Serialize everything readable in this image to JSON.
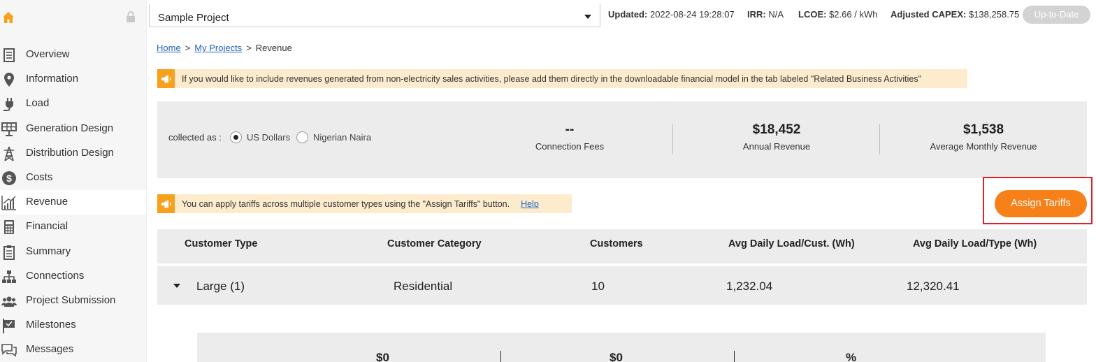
{
  "sidebar": {
    "items": [
      {
        "label": "Overview",
        "icon": "overview-icon"
      },
      {
        "label": "Information",
        "icon": "map-pin-icon"
      },
      {
        "label": "Load",
        "icon": "plug-icon"
      },
      {
        "label": "Generation Design",
        "icon": "solar-panel-icon"
      },
      {
        "label": "Distribution Design",
        "icon": "tower-icon"
      },
      {
        "label": "Costs",
        "icon": "dollar-coin-icon"
      },
      {
        "label": "Revenue",
        "icon": "bar-chart-icon",
        "active": true
      },
      {
        "label": "Financial",
        "icon": "calculator-icon"
      },
      {
        "label": "Summary",
        "icon": "document-icon"
      },
      {
        "label": "Connections",
        "icon": "network-icon"
      },
      {
        "label": "Project Submission",
        "icon": "users-icon"
      },
      {
        "label": "Milestones",
        "icon": "flag-icon"
      },
      {
        "label": "Messages",
        "icon": "chat-icon"
      }
    ]
  },
  "topbar": {
    "project": "Sample Project",
    "updated_label": "Updated:",
    "updated_value": "2022-08-24 19:28:07",
    "irr_label": "IRR:",
    "irr_value": "N/A",
    "lcoe_label": "LCOE:",
    "lcoe_value": "$2.66 / kWh",
    "capex_label": "Adjusted CAPEX:",
    "capex_value": "$138,258.75",
    "status_button": "Up-to-Date"
  },
  "breadcrumb": {
    "home": "Home",
    "projects": "My Projects",
    "current": "Revenue",
    "sep": ">"
  },
  "notices": {
    "top": "If you would like to include revenues generated from non-electricity sales activities, please add them directly in the downloadable financial model in the tab labeled \"Related Business Activities\"",
    "tariff": "You can apply tariffs across multiple customer types using the \"Assign Tariffs\" button.",
    "help": "Help"
  },
  "summary": {
    "collected_label": "collected as :",
    "currencies": [
      "US Dollars",
      "Nigerian Naira"
    ],
    "selected_currency": "US Dollars",
    "metrics": [
      {
        "value": "--",
        "label": "Connection Fees"
      },
      {
        "value": "$18,452",
        "label": "Annual Revenue"
      },
      {
        "value": "$1,538",
        "label": "Average Monthly Revenue"
      }
    ]
  },
  "assign_button": "Assign Tariffs",
  "table": {
    "columns": [
      "Customer Type",
      "Customer Category",
      "Customers",
      "Avg Daily Load/Cust. (Wh)",
      "Avg Daily Load/Type (Wh)"
    ],
    "rows": [
      {
        "type": "Large (1)",
        "category": "Residential",
        "customers": "10",
        "load_per_cust": "1,232.04",
        "load_per_type": "12,320.41"
      }
    ]
  },
  "subpanel": {
    "values": [
      "$0",
      "$0",
      "%"
    ]
  },
  "colors": {
    "accent": "#f78018",
    "notice_bg": "#fdebcd",
    "notice_icon": "#f7a01c",
    "panel_bg": "#ececec",
    "highlight": "#e3202a"
  }
}
